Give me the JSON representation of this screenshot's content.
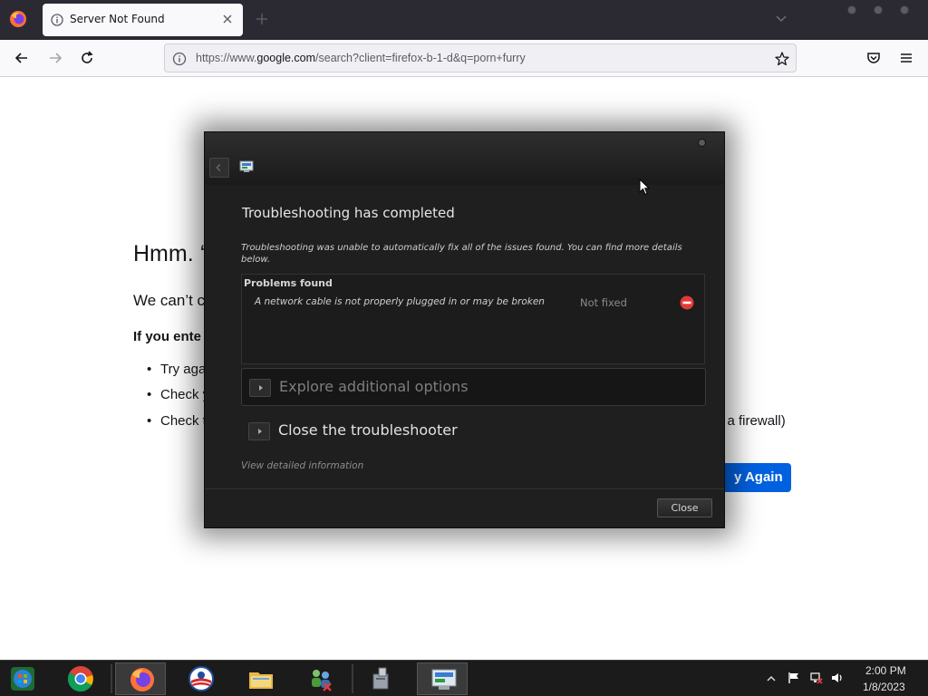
{
  "browser": {
    "tab": {
      "title": "Server Not Found"
    },
    "url": {
      "prefix": "https://www.",
      "host": "google.com",
      "path": "/search?client=firefox-b-1-d&q=porn+furry"
    }
  },
  "error_page": {
    "title": "Hmm. ‘",
    "line": "We can’t c",
    "bold": "If you ente",
    "items": [
      "Try aga",
      "Check y",
      "Check t"
    ],
    "item_tail": "d a firewall)",
    "try_again_label": "y Again"
  },
  "dialog": {
    "heading": "Troubleshooting has completed",
    "description": "Troubleshooting was unable to automatically fix all of the issues found. You can find more details below.",
    "problems_title": "Problems found",
    "problems": [
      {
        "text": "A network cable is not properly plugged in or may be broken",
        "status": "Not fixed"
      }
    ],
    "options": {
      "explore": "Explore additional options",
      "close_troubleshooter": "Close the troubleshooter"
    },
    "view_details": "View detailed information",
    "close_button": "Close"
  },
  "taskbar": {
    "apps": [
      "windows-start-orb",
      "chrome",
      "firefox",
      "obama-campaign-logo",
      "file-explorer",
      "network-icon",
      "tool-icon",
      "troubleshooter"
    ],
    "time": "2:00 PM",
    "date": "1/8/2023"
  },
  "colors": {
    "accent_blue": "#0061e0",
    "dialog_bg": "#1f1f1f",
    "error_red": "#e03a3a"
  }
}
